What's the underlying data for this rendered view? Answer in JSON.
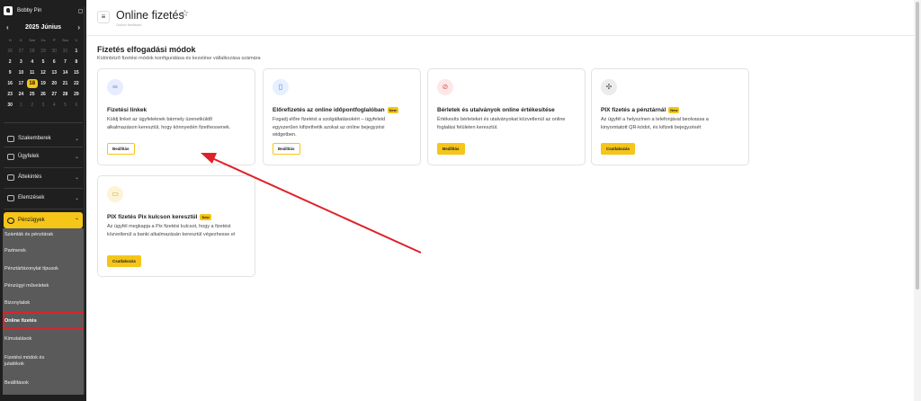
{
  "sidebar": {
    "user_name": "Bobby Pin",
    "calendar": {
      "title": "2025 Június",
      "prev": "‹",
      "next": "›",
      "weekdays": [
        "H",
        "K",
        "Sze",
        "Cs",
        "P",
        "Szo",
        "V"
      ],
      "days": [
        {
          "d": "26",
          "muted": true
        },
        {
          "d": "27",
          "muted": true
        },
        {
          "d": "28",
          "muted": true
        },
        {
          "d": "29",
          "muted": true
        },
        {
          "d": "30",
          "muted": true
        },
        {
          "d": "31",
          "muted": true
        },
        {
          "d": "1"
        },
        {
          "d": "2"
        },
        {
          "d": "3"
        },
        {
          "d": "4"
        },
        {
          "d": "5"
        },
        {
          "d": "6"
        },
        {
          "d": "7"
        },
        {
          "d": "8"
        },
        {
          "d": "9"
        },
        {
          "d": "10"
        },
        {
          "d": "11"
        },
        {
          "d": "12"
        },
        {
          "d": "13"
        },
        {
          "d": "14"
        },
        {
          "d": "15"
        },
        {
          "d": "16"
        },
        {
          "d": "17"
        },
        {
          "d": "18",
          "today": true
        },
        {
          "d": "19"
        },
        {
          "d": "20"
        },
        {
          "d": "21"
        },
        {
          "d": "22"
        },
        {
          "d": "23"
        },
        {
          "d": "24"
        },
        {
          "d": "25"
        },
        {
          "d": "26"
        },
        {
          "d": "27"
        },
        {
          "d": "28"
        },
        {
          "d": "29"
        },
        {
          "d": "30"
        },
        {
          "d": "1",
          "muted": true
        },
        {
          "d": "2",
          "muted": true
        },
        {
          "d": "3",
          "muted": true
        },
        {
          "d": "4",
          "muted": true
        },
        {
          "d": "5",
          "muted": true
        },
        {
          "d": "6",
          "muted": true
        }
      ]
    },
    "nav": {
      "szakemberek": "Szakemberek",
      "ugyfelek": "Ügyfelek",
      "attekintes": "Áttekintés",
      "elemzesek": "Elemzések",
      "penzugyek": "Pénzügyek"
    },
    "sub": {
      "szamlak": "Számlák és pénztárak",
      "partnerek": "Partnerek",
      "tipusok": "Pénztárbizonylat típusok",
      "muveletek": "Pénzügyi műveletek",
      "bizonylatok": "Bizonylatok",
      "online": "Online fizetés",
      "kimutatasok": "Kimutatások",
      "fizmodok": "Fizetési módok és jutalékok",
      "beallitasok": "Beállítások"
    }
  },
  "header": {
    "title": "Online fizetés",
    "breadcrumb": "Online fizetések"
  },
  "main": {
    "section_title": "Fizetés elfogadási módok",
    "section_subtitle": "Különböző fizetési módok konfigurálása és kezelése vállalkozása számára",
    "new_badge": "New",
    "cards": [
      {
        "title": "Fizetési linkek",
        "desc": "Küldj linket az ügyfeleknek bármely üzenetküldő alkalmazáson keresztül, hogy könnyedén fizethessenek.",
        "button": "Beállítás"
      },
      {
        "title": "Előrefizetés az online időpontfoglalóban",
        "desc": "Fogadj előre fizetést a szolgáltatásokért – ügyfeleid egyszerűen kifizethetik azokat az online bejegyzési widgetben.",
        "button": "Beállítás"
      },
      {
        "title": "Bérletek és utalványok online értékesítése",
        "desc": "Értékesíts bérleteket és utalványokat közvetlenül az online foglalási felületen keresztül.",
        "button": "Beállítás"
      },
      {
        "title": "PIX fizetés a pénztárnál",
        "desc": "Az ügyfél a helyszínen a telefonjával beolvassa a kinyomtatott QR-kódot, és kifizeti bejegyzését",
        "button": "Csatlakozás"
      },
      {
        "title": "PIX fizetés Pix kulcson keresztül",
        "desc": "Az ügyfél megkapja a Pix fizetési kulcsot, hogy a fizetést közvetlenül a banki alkalmazásán keresztül végezhesse el",
        "button": "Csatlakozás"
      }
    ]
  },
  "colors": {
    "accent": "#f5c518",
    "highlight": "#e0212a",
    "sidebar": "#1f1f1f"
  },
  "icons": [
    "link-icon",
    "phone-icon",
    "coupon-icon",
    "pix-icon",
    "card-icon",
    "star-icon",
    "menu-icon"
  ]
}
